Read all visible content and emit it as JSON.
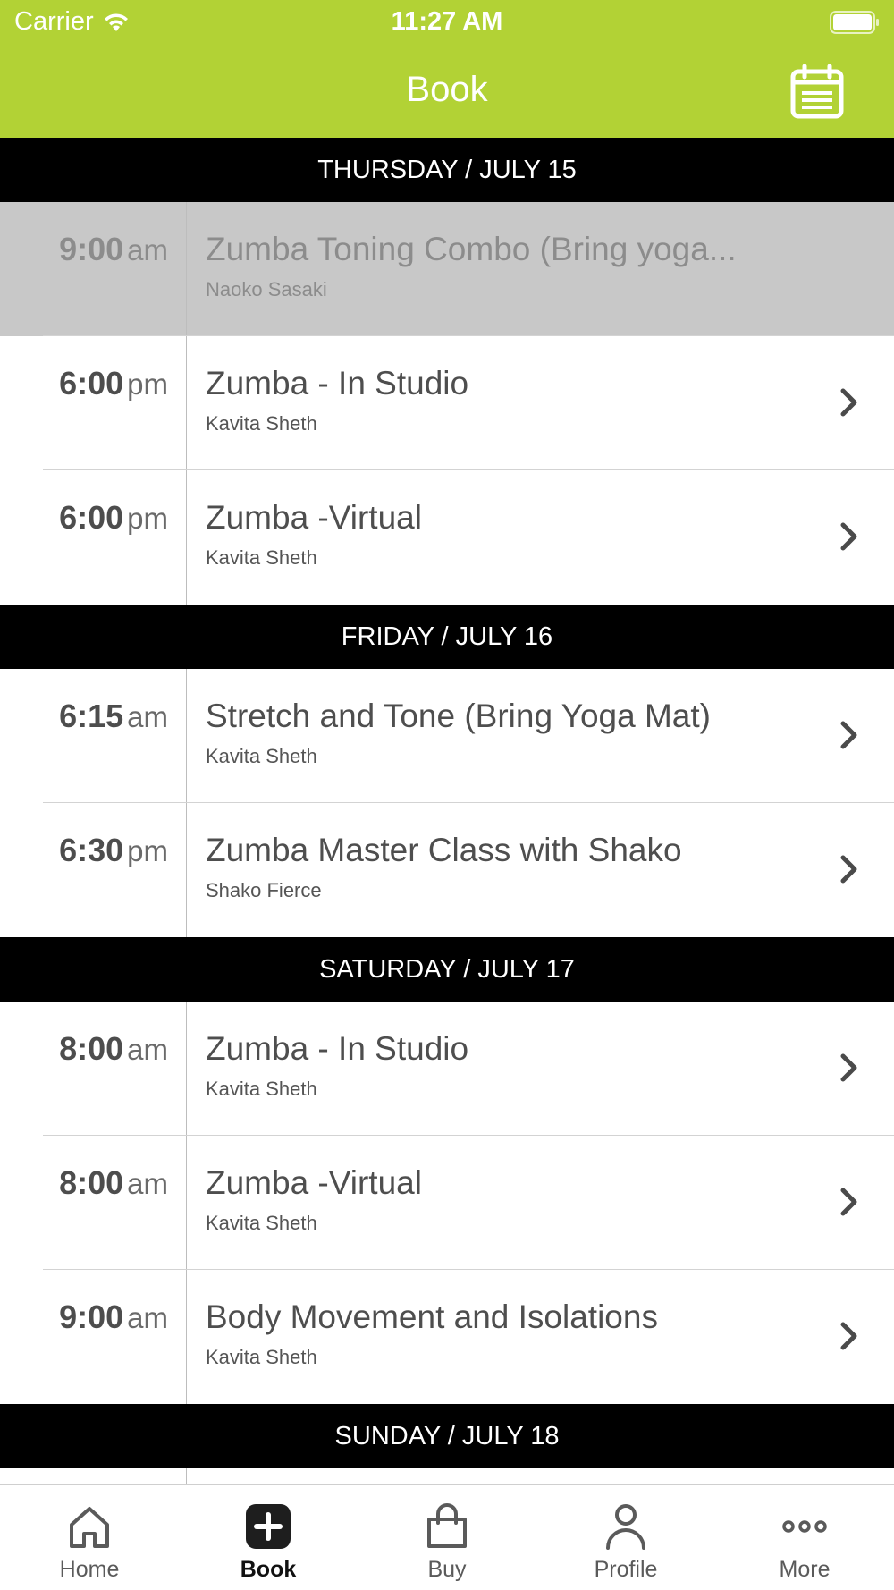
{
  "status_bar": {
    "carrier": "Carrier",
    "time": "11:27 AM"
  },
  "header": {
    "title": "Book",
    "accent_color": "#b2d235"
  },
  "days": [
    {
      "label": "THURSDAY / JULY 15",
      "classes": [
        {
          "time": "9:00",
          "ampm": "am",
          "name": "Zumba Toning Combo (Bring yoga...",
          "instructor": "Naoko Sasaki",
          "past": true
        },
        {
          "time": "6:00",
          "ampm": "pm",
          "name": "Zumba - In Studio",
          "instructor": "Kavita Sheth",
          "past": false
        },
        {
          "time": "6:00",
          "ampm": "pm",
          "name": "Zumba -Virtual",
          "instructor": "Kavita Sheth",
          "past": false
        }
      ]
    },
    {
      "label": "FRIDAY / JULY 16",
      "classes": [
        {
          "time": "6:15",
          "ampm": "am",
          "name": "Stretch and Tone (Bring Yoga Mat)",
          "instructor": "Kavita Sheth",
          "past": false
        },
        {
          "time": "6:30",
          "ampm": "pm",
          "name": "Zumba Master Class with Shako",
          "instructor": "Shako Fierce",
          "past": false
        }
      ]
    },
    {
      "label": "SATURDAY / JULY 17",
      "classes": [
        {
          "time": "8:00",
          "ampm": "am",
          "name": "Zumba - In Studio",
          "instructor": "Kavita Sheth",
          "past": false
        },
        {
          "time": "8:00",
          "ampm": "am",
          "name": "Zumba -Virtual",
          "instructor": "Kavita Sheth",
          "past": false
        },
        {
          "time": "9:00",
          "ampm": "am",
          "name": "Body Movement and Isolations",
          "instructor": "Kavita Sheth",
          "past": false
        }
      ]
    },
    {
      "label": "SUNDAY / JULY 18",
      "classes": []
    }
  ],
  "tabs": [
    {
      "label": "Home",
      "icon": "home-icon",
      "active": false
    },
    {
      "label": "Book",
      "icon": "plus-square-icon",
      "active": true
    },
    {
      "label": "Buy",
      "icon": "shopping-bag-icon",
      "active": false
    },
    {
      "label": "Profile",
      "icon": "person-icon",
      "active": false
    },
    {
      "label": "More",
      "icon": "more-dots-icon",
      "active": false
    }
  ]
}
